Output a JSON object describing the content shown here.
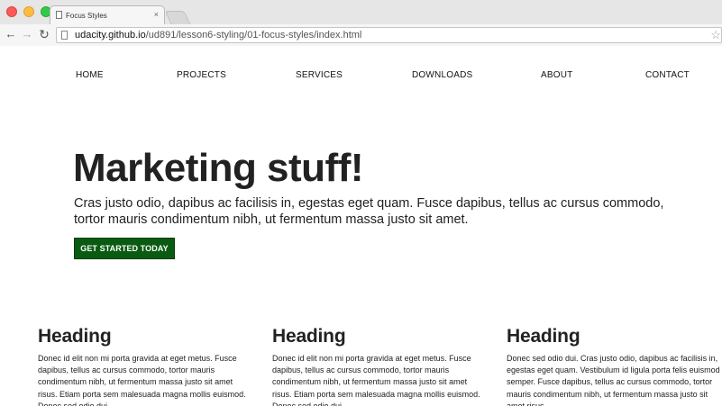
{
  "browser": {
    "tab_title": "Focus Styles",
    "tab_close": "×",
    "url_domain": "udacity.github.io",
    "url_path": "/ud891/lesson6-styling/01-focus-styles/index.html",
    "back_glyph": "←",
    "forward_glyph": "→",
    "reload_glyph": "↻",
    "star_glyph": "☆",
    "colors": {
      "close": "#fc5b57",
      "minimize": "#fdbc40",
      "maximize": "#34c84a"
    }
  },
  "site_nav": {
    "items": [
      {
        "label": "HOME"
      },
      {
        "label": "PROJECTS"
      },
      {
        "label": "SERVICES"
      },
      {
        "label": "DOWNLOADS"
      },
      {
        "label": "ABOUT"
      },
      {
        "label": "CONTACT"
      }
    ]
  },
  "hero": {
    "title": "Marketing stuff!",
    "text": "Cras justo odio, dapibus ac facilisis in, egestas eget quam. Fusce dapibus, tellus ac cursus commodo, tortor mauris condimentum nibh, ut fermentum massa justo sit amet.",
    "button_label": "GET STARTED TODAY",
    "button_color": "#0a5b12"
  },
  "columns": [
    {
      "heading": "Heading",
      "text": "Donec id elit non mi porta gravida at eget metus. Fusce dapibus, tellus ac cursus commodo, tortor mauris condimentum nibh, ut fermentum massa justo sit amet risus. Etiam porta sem malesuada magna mollis euismod. Donec sed odio dui."
    },
    {
      "heading": "Heading",
      "text": "Donec id elit non mi porta gravida at eget metus. Fusce dapibus, tellus ac cursus commodo, tortor mauris condimentum nibh, ut fermentum massa justo sit amet risus. Etiam porta sem malesuada magna mollis euismod. Donec sed odio dui."
    },
    {
      "heading": "Heading",
      "text": "Donec sed odio dui. Cras justo odio, dapibus ac facilisis in, egestas eget quam. Vestibulum id ligula porta felis euismod semper. Fusce dapibus, tellus ac cursus commodo, tortor mauris condimentum nibh, ut fermentum massa justo sit amet risus."
    }
  ]
}
